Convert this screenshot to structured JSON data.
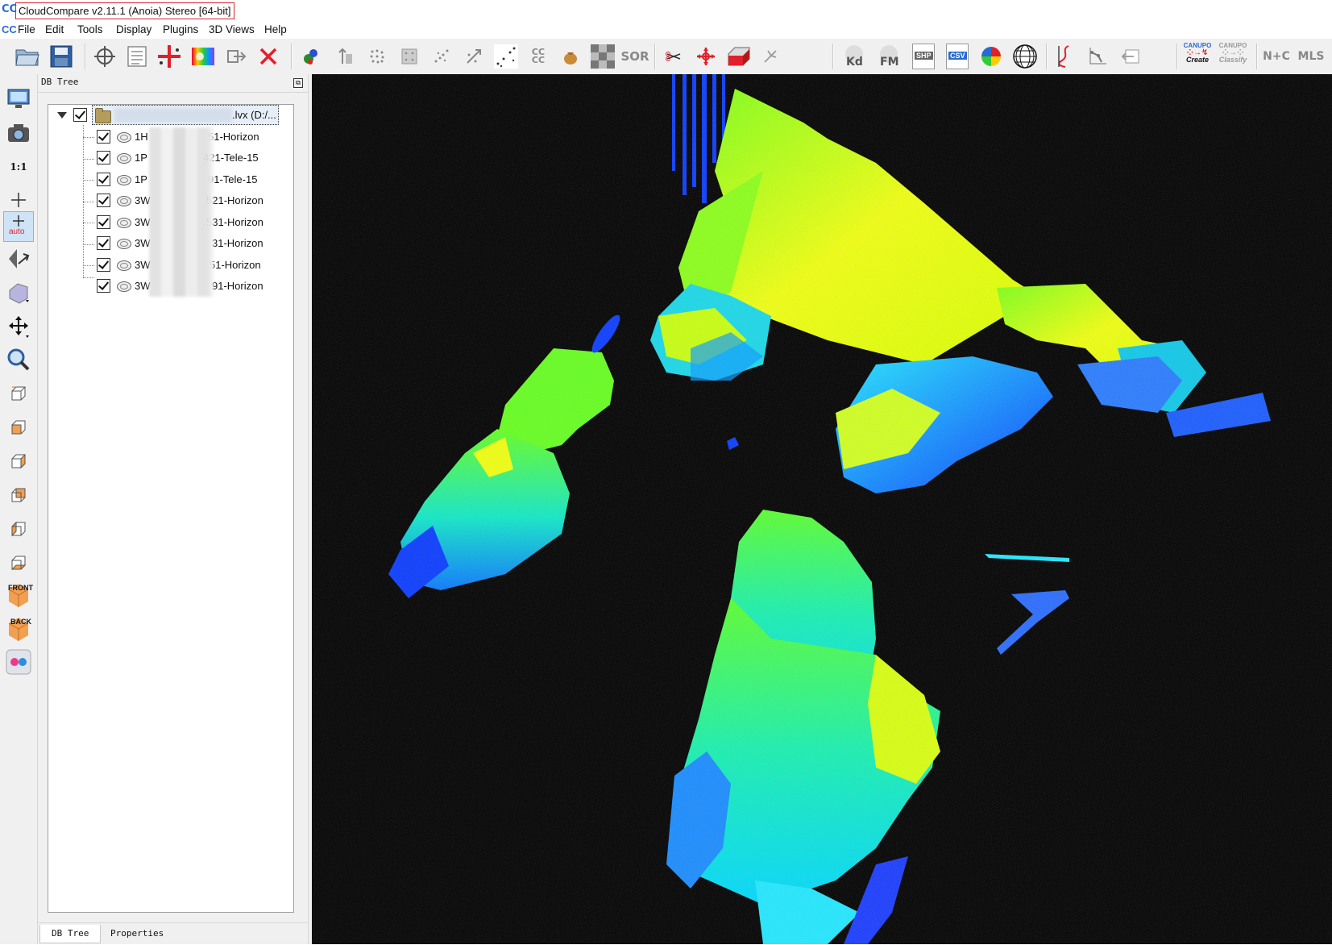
{
  "window": {
    "title": "CloudCompare v2.11.1 (Anoia) Stereo [64-bit]"
  },
  "menu": [
    "File",
    "Edit",
    "Tools",
    "Display",
    "Plugins",
    "3D Views",
    "Help"
  ],
  "toolbar": {
    "labels": {
      "sor": "SOR",
      "kd": "Kd",
      "fm": "FM",
      "shp": "SHP",
      "csv": "CSV",
      "canupo_create_top": "CANUPO",
      "canupo_create": "Create",
      "canupo_classify_top": "CANUPO",
      "canupo_classify": "Classify",
      "nc": "N+C",
      "mls": "MLS",
      "cc": "CC\nCC"
    }
  },
  "left_toolbar": {
    "one_to_one": "1:1",
    "auto": "auto",
    "front": "FRONT",
    "back": "BACK"
  },
  "db_tree": {
    "panel_title": "DB Tree",
    "root": {
      "label": ".lvx (D:/...",
      "checked": true
    },
    "items": [
      {
        "label": "1H",
        "suffix": "51-Horizon",
        "checked": true
      },
      {
        "label": "1P",
        "suffix": "421-Tele-15",
        "checked": true
      },
      {
        "label": "1P",
        "suffix": "91-Tele-15",
        "checked": true
      },
      {
        "label": "3W",
        "suffix": "521-Horizon",
        "checked": true
      },
      {
        "label": "3W",
        "suffix": "531-Horizon",
        "checked": true
      },
      {
        "label": "3W",
        "suffix": "31-Horizon",
        "checked": true
      },
      {
        "label": "3W",
        "suffix": "51-Horizon",
        "checked": true
      },
      {
        "label": "3W",
        "suffix": "91-Horizon",
        "checked": true
      }
    ],
    "tabs": [
      "DB Tree",
      "Properties"
    ]
  },
  "colors": {
    "viewport_bg": "#000000",
    "accent_red": "#e0202a",
    "selection": "#cfe3f7"
  }
}
